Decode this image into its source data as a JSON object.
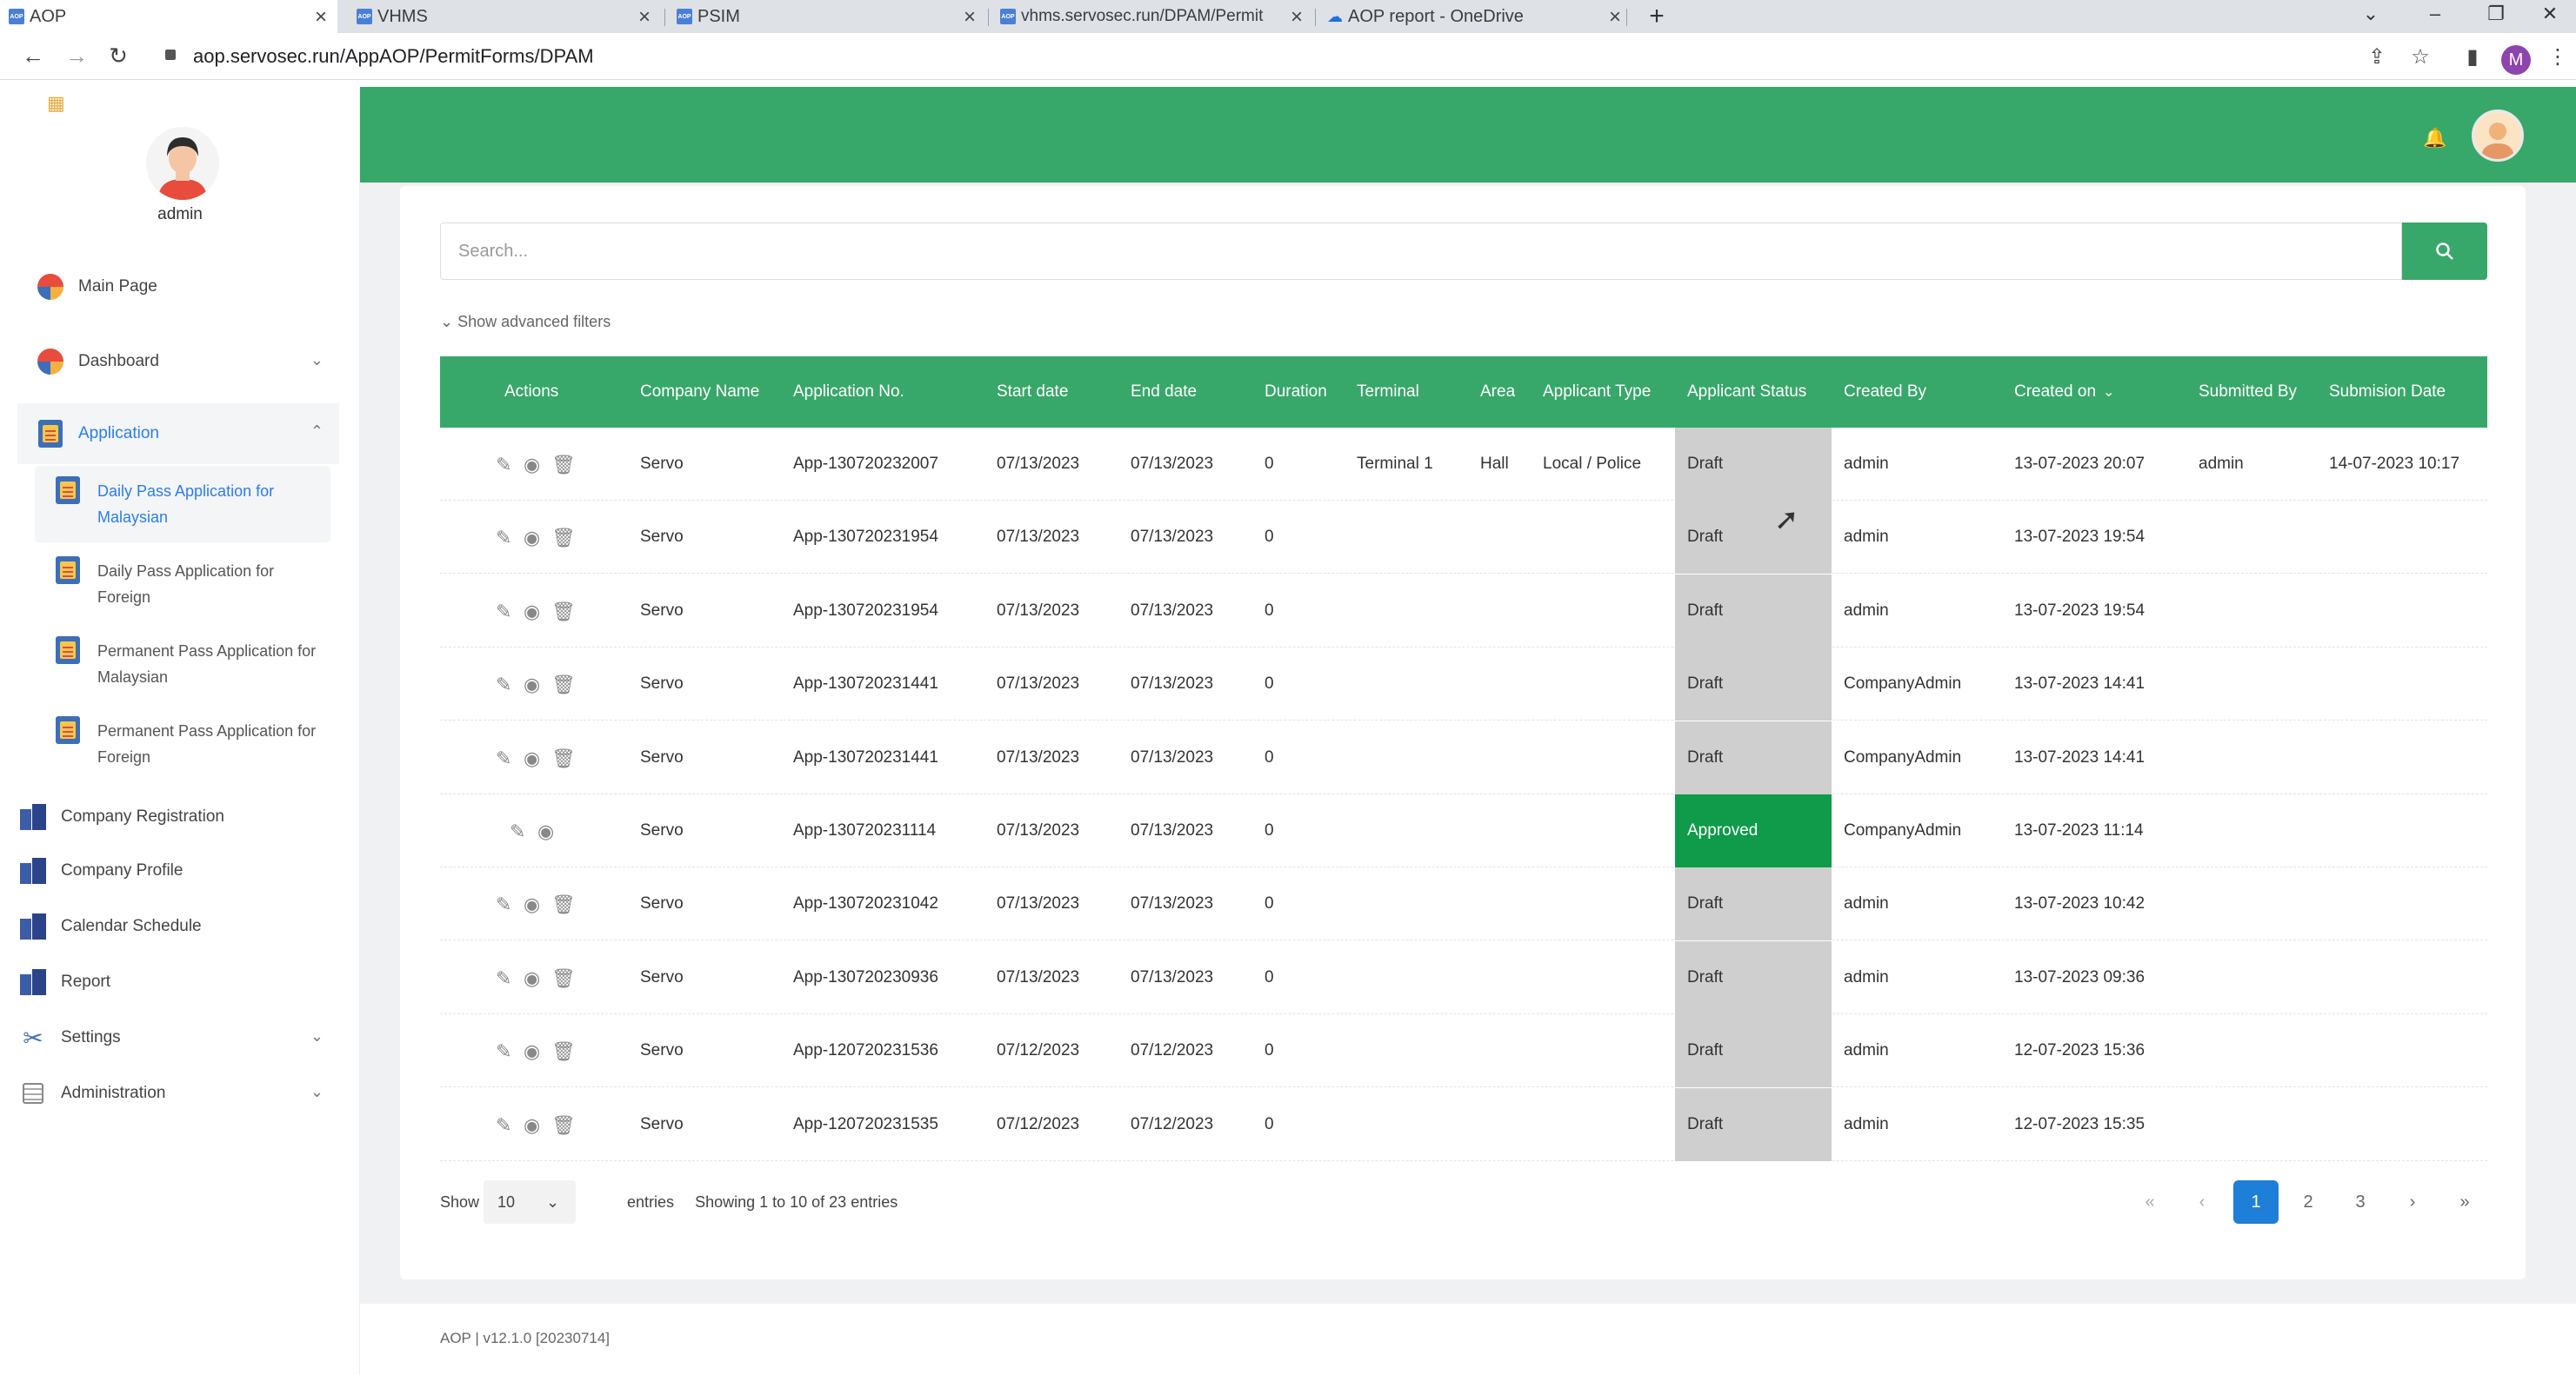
{
  "browser": {
    "tabs": [
      {
        "title": "AOP",
        "favicon": "aop-icon",
        "active": true
      },
      {
        "title": "VHMS",
        "favicon": "aop-icon",
        "active": false
      },
      {
        "title": "PSIM",
        "favicon": "aop-icon",
        "active": false
      },
      {
        "title": "vhms.servosec.run/DPAM/Permit",
        "favicon": "aop-icon",
        "active": false
      },
      {
        "title": "AOP report - OneDrive",
        "favicon": "onedrive-icon",
        "active": false
      }
    ],
    "url": "aop.servosec.run/AppAOP/PermitForms/DPAM",
    "profile_initial": "M"
  },
  "sidebar": {
    "username": "admin",
    "items": [
      {
        "label": "Main Page",
        "icon": "dashboard-icon"
      },
      {
        "label": "Dashboard",
        "icon": "dashboard-icon"
      },
      {
        "label": "Application",
        "icon": "application-icon"
      },
      {
        "label": "Company Registration",
        "icon": "building-icon"
      },
      {
        "label": "Company Profile",
        "icon": "building-icon"
      },
      {
        "label": "Calendar Schedule",
        "icon": "building-icon"
      },
      {
        "label": "Report",
        "icon": "building-icon"
      },
      {
        "label": "Settings",
        "icon": "tools-icon"
      },
      {
        "label": "Administration",
        "icon": "admin-icon"
      }
    ],
    "application_sub": [
      {
        "line1": "Daily Pass Application for",
        "line2": "Malaysian"
      },
      {
        "line1": "Daily Pass Application for",
        "line2": "Foreign"
      },
      {
        "line1": "Permanent Pass Application for",
        "line2": "Malaysian"
      },
      {
        "line1": "Permanent Pass Application for",
        "line2": "Foreign"
      }
    ]
  },
  "search": {
    "placeholder": "Search...",
    "advanced": "Show advanced filters"
  },
  "table": {
    "headers": [
      "Actions",
      "Company Name",
      "Application No.",
      "Start date",
      "End date",
      "Duration",
      "Terminal",
      "Area",
      "Applicant Type",
      "Applicant Status",
      "Created By",
      "Created on",
      "Submitted By",
      "Submision Date"
    ],
    "rows": [
      {
        "company": "Servo",
        "app_no": "App-130720232007",
        "start": "07/13/2023",
        "end": "07/13/2023",
        "duration": "0",
        "terminal": "Terminal 1",
        "area": "Hall",
        "type": "Local / Police",
        "status": "Draft",
        "created_by": "admin",
        "created_on": "13-07-2023 20:07",
        "submitted_by": "admin",
        "submission_date": "14-07-2023 10:17"
      },
      {
        "company": "Servo",
        "app_no": "App-130720231954",
        "start": "07/13/2023",
        "end": "07/13/2023",
        "duration": "0",
        "terminal": "",
        "area": "",
        "type": "",
        "status": "Draft",
        "created_by": "admin",
        "created_on": "13-07-2023 19:54",
        "submitted_by": "",
        "submission_date": ""
      },
      {
        "company": "Servo",
        "app_no": "App-130720231954",
        "start": "07/13/2023",
        "end": "07/13/2023",
        "duration": "0",
        "terminal": "",
        "area": "",
        "type": "",
        "status": "Draft",
        "created_by": "admin",
        "created_on": "13-07-2023 19:54",
        "submitted_by": "",
        "submission_date": ""
      },
      {
        "company": "Servo",
        "app_no": "App-130720231441",
        "start": "07/13/2023",
        "end": "07/13/2023",
        "duration": "0",
        "terminal": "",
        "area": "",
        "type": "",
        "status": "Draft",
        "created_by": "CompanyAdmin",
        "created_on": "13-07-2023 14:41",
        "submitted_by": "",
        "submission_date": ""
      },
      {
        "company": "Servo",
        "app_no": "App-130720231441",
        "start": "07/13/2023",
        "end": "07/13/2023",
        "duration": "0",
        "terminal": "",
        "area": "",
        "type": "",
        "status": "Draft",
        "created_by": "CompanyAdmin",
        "created_on": "13-07-2023 14:41",
        "submitted_by": "",
        "submission_date": ""
      },
      {
        "company": "Servo",
        "app_no": "App-130720231114",
        "start": "07/13/2023",
        "end": "07/13/2023",
        "duration": "0",
        "terminal": "",
        "area": "",
        "type": "",
        "status": "Approved",
        "created_by": "CompanyAdmin",
        "created_on": "13-07-2023 11:14",
        "submitted_by": "",
        "submission_date": ""
      },
      {
        "company": "Servo",
        "app_no": "App-130720231042",
        "start": "07/13/2023",
        "end": "07/13/2023",
        "duration": "0",
        "terminal": "",
        "area": "",
        "type": "",
        "status": "Draft",
        "created_by": "admin",
        "created_on": "13-07-2023 10:42",
        "submitted_by": "",
        "submission_date": ""
      },
      {
        "company": "Servo",
        "app_no": "App-130720230936",
        "start": "07/13/2023",
        "end": "07/13/2023",
        "duration": "0",
        "terminal": "",
        "area": "",
        "type": "",
        "status": "Draft",
        "created_by": "admin",
        "created_on": "13-07-2023 09:36",
        "submitted_by": "",
        "submission_date": ""
      },
      {
        "company": "Servo",
        "app_no": "App-120720231536",
        "start": "07/12/2023",
        "end": "07/12/2023",
        "duration": "0",
        "terminal": "",
        "area": "",
        "type": "",
        "status": "Draft",
        "created_by": "admin",
        "created_on": "12-07-2023 15:36",
        "submitted_by": "",
        "submission_date": ""
      },
      {
        "company": "Servo",
        "app_no": "App-120720231535",
        "start": "07/12/2023",
        "end": "07/12/2023",
        "duration": "0",
        "terminal": "",
        "area": "",
        "type": "",
        "status": "Draft",
        "created_by": "admin",
        "created_on": "12-07-2023 15:35",
        "submitted_by": "",
        "submission_date": ""
      }
    ]
  },
  "pagination": {
    "show": "Show",
    "page_size": "10",
    "entries": "entries",
    "info": "Showing 1 to 10 of 23 entries",
    "pages": [
      "1",
      "2",
      "3"
    ],
    "current": "1",
    "first": "«",
    "prev": "‹",
    "next": "›",
    "last": "»"
  },
  "footer": "AOP | v12.1.0 [20230714]",
  "colors": {
    "brand_green": "#38a76a",
    "approved": "#0f9b4a",
    "draft_bg": "#cfcfcf",
    "active_page": "#1e7fd8"
  }
}
